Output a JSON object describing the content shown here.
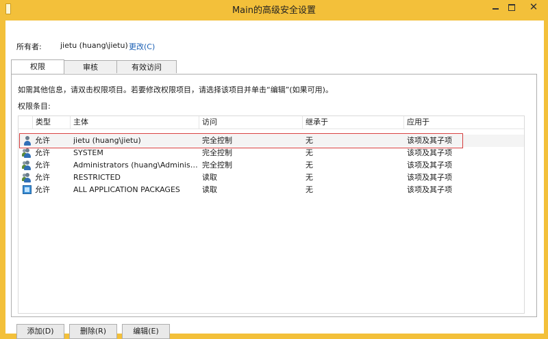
{
  "window": {
    "title": "Main的高级安全设置",
    "controls": {
      "min": "minimize",
      "max": "maximize",
      "close": "✕"
    }
  },
  "owner": {
    "label": "所有者:",
    "value": "jietu (huang\\jietu)",
    "change_link": "更改(C)"
  },
  "tabs": [
    {
      "label": "权限",
      "active": true
    },
    {
      "label": "审核",
      "active": false
    },
    {
      "label": "有效访问",
      "active": false
    }
  ],
  "permissions": {
    "info_text": "如需其他信息，请双击权限项目。若要修改权限项目，请选择该项目并单击“编辑”(如果可用)。",
    "entries_label": "权限条目:",
    "columns": [
      "类型",
      "主体",
      "访问",
      "继承于",
      "应用于"
    ],
    "rows": [
      {
        "icon": "user-icon",
        "type": "允许",
        "principal": "jietu (huang\\jietu)",
        "access": "完全控制",
        "inherited": "无",
        "applies_to": "该项及其子项"
      },
      {
        "icon": "group-icon",
        "type": "允许",
        "principal": "SYSTEM",
        "access": "完全控制",
        "inherited": "无",
        "applies_to": "该项及其子项"
      },
      {
        "icon": "group-icon",
        "type": "允许",
        "principal": "Administrators (huang\\Administr...",
        "access": "完全控制",
        "inherited": "无",
        "applies_to": "该项及其子项"
      },
      {
        "icon": "group-icon",
        "type": "允许",
        "principal": "RESTRICTED",
        "access": "读取",
        "inherited": "无",
        "applies_to": "该项及其子项"
      },
      {
        "icon": "package-icon",
        "type": "允许",
        "principal": "ALL APPLICATION PACKAGES",
        "access": "读取",
        "inherited": "无",
        "applies_to": "该项及其子项"
      }
    ]
  },
  "buttons": {
    "add": "添加(D)",
    "remove": "删除(R)",
    "edit": "编辑(E)"
  },
  "colors": {
    "titlebar": "#f3c03a",
    "link": "#1a5fb4",
    "highlight_outline": "#d33a3a"
  }
}
